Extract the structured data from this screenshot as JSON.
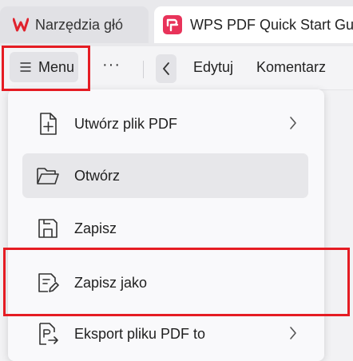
{
  "tabs": [
    {
      "label": "Narzędzia głó",
      "icon": "wps-logo-icon"
    },
    {
      "label": "WPS PDF Quick Start Guid",
      "icon": "wps-pdf-icon"
    }
  ],
  "toolbar": {
    "menu_label": "Menu",
    "more_label": "···",
    "items": [
      "Edytuj",
      "Komentarz"
    ]
  },
  "menu": {
    "items": [
      {
        "label": "Utwórz plik PDF",
        "icon": "file-plus-icon",
        "submenu": true
      },
      {
        "label": "Otwórz",
        "icon": "folder-open-icon",
        "submenu": false
      },
      {
        "label": "Zapisz",
        "icon": "save-icon",
        "submenu": false
      },
      {
        "label": "Zapisz jako",
        "icon": "save-as-icon",
        "submenu": false
      },
      {
        "label": "Eksport pliku PDF to",
        "icon": "export-icon",
        "submenu": true
      }
    ]
  },
  "colors": {
    "highlight": "#e51c23",
    "wps_red": "#e0232e",
    "pdf_pink": "#e8335a"
  }
}
